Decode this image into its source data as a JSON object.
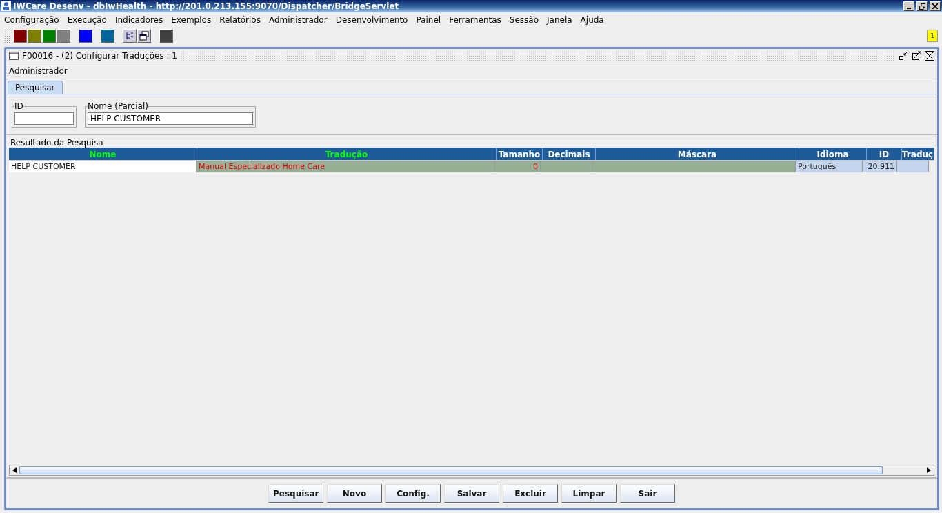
{
  "window": {
    "title": "IWCare Desenv - dbIwHealth - http://201.0.213.155:9070/Dispatcher/BridgeServlet"
  },
  "menu": [
    "Configuração",
    "Execução",
    "Indicadores",
    "Exemplos",
    "Relatórios",
    "Administrador",
    "Desenvolvimento",
    "Painel",
    "Ferramentas",
    "Sessão",
    "Janela",
    "Ajuda"
  ],
  "toolbar": [
    {
      "kind": "swatch",
      "color": "#800000"
    },
    {
      "kind": "swatch",
      "color": "#808000"
    },
    {
      "kind": "swatch",
      "color": "#008000"
    },
    {
      "kind": "swatch",
      "color": "#808080"
    },
    {
      "kind": "gap"
    },
    {
      "kind": "swatch",
      "color": "#0000ff"
    },
    {
      "kind": "gap"
    },
    {
      "kind": "swatch",
      "color": "#006699"
    },
    {
      "kind": "gap"
    },
    {
      "kind": "tree"
    },
    {
      "kind": "windows"
    },
    {
      "kind": "gap"
    },
    {
      "kind": "swatch",
      "color": "#404040"
    }
  ],
  "notification_badge": "1",
  "frame": {
    "title": "F00016 - (2) Configurar Traduções : 1",
    "section": "Administrador",
    "tabs": [
      {
        "label": "Pesquisar",
        "selected": true
      }
    ],
    "filters": [
      {
        "label": "ID"
      },
      {
        "label": "Nome (Parcial)",
        "value": "HELP CUSTOMER"
      }
    ],
    "results": {
      "title": "Resultado da Pesquisa",
      "columns": [
        {
          "label": "Nome",
          "highlight": true,
          "kind": "plain"
        },
        {
          "label": "Tradução",
          "highlight": true,
          "kind": "edit"
        },
        {
          "label": "Tamanho",
          "highlight": false,
          "kind": "edit"
        },
        {
          "label": "Decimais",
          "highlight": false,
          "kind": "edit"
        },
        {
          "label": "Máscara",
          "highlight": false,
          "kind": "edit"
        },
        {
          "label": "Idioma",
          "highlight": false,
          "kind": "info"
        },
        {
          "label": "ID",
          "highlight": false,
          "kind": "info"
        },
        {
          "label": "Traduç",
          "highlight": false,
          "kind": "info"
        }
      ],
      "rows": [
        [
          "HELP CUSTOMER",
          "Manual Especializado Home Care",
          "0",
          null,
          null,
          "Português",
          "20.911",
          null
        ]
      ]
    },
    "buttons": [
      "Pesquisar",
      "Novo",
      "Config.",
      "Salvar",
      "Excluir",
      "Limpar",
      "Sair"
    ]
  }
}
